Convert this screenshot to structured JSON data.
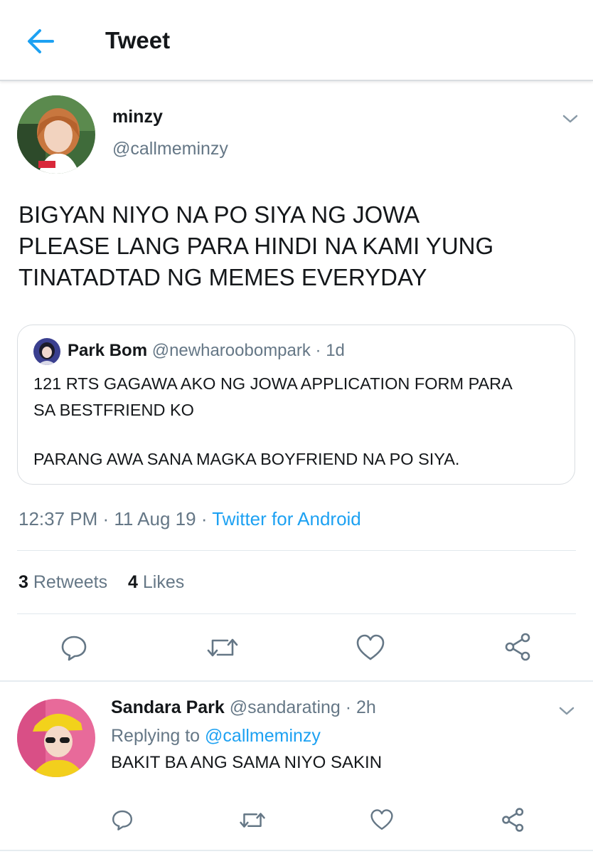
{
  "header": {
    "title": "Tweet",
    "back_icon": "arrow-left-icon",
    "accent_color": "#1da1f2"
  },
  "tweet": {
    "author_name": "minzy",
    "author_handle": "@callmeminzy",
    "text_lines": [
      "BIGYAN NIYO NA PO SIYA NG JOWA",
      "PLEASE LANG PARA HINDI NA KAMI YUNG",
      "TINATADTAD NG MEMES EVERYDAY"
    ],
    "quoted": {
      "name": "Park Bom",
      "handle": "@newharoobompark",
      "separator": " · ",
      "time": "1d",
      "text_lines": [
        "121 RTS GAGAWA AKO NG JOWA APPLICATION FORM PARA",
        "SA BESTFRIEND KO",
        "",
        "PARANG AWA SANA MAGKA BOYFRIEND NA PO SIYA."
      ]
    },
    "meta": {
      "time": "12:37 PM",
      "separator": " · ",
      "date": "11 Aug 19",
      "source": "Twitter for Android"
    },
    "stats": {
      "retweets_count": "3",
      "retweets_label": "Retweets",
      "likes_count": "4",
      "likes_label": "Likes"
    },
    "actions": [
      "reply-icon",
      "retweet-icon",
      "like-icon",
      "share-icon"
    ]
  },
  "reply": {
    "name": "Sandara Park",
    "handle": "@sandarating",
    "separator": " · ",
    "time": "2h",
    "replying_to_label": "Replying to",
    "replying_to_handle": "@callmeminzy",
    "text": "BAKIT BA ANG SAMA NIYO SAKIN",
    "actions": [
      "reply-icon",
      "retweet-icon",
      "like-icon",
      "share-icon"
    ]
  },
  "colors": {
    "text": "#14171a",
    "secondary": "#657786",
    "link": "#1da1f2",
    "border": "#e1e8ed"
  }
}
